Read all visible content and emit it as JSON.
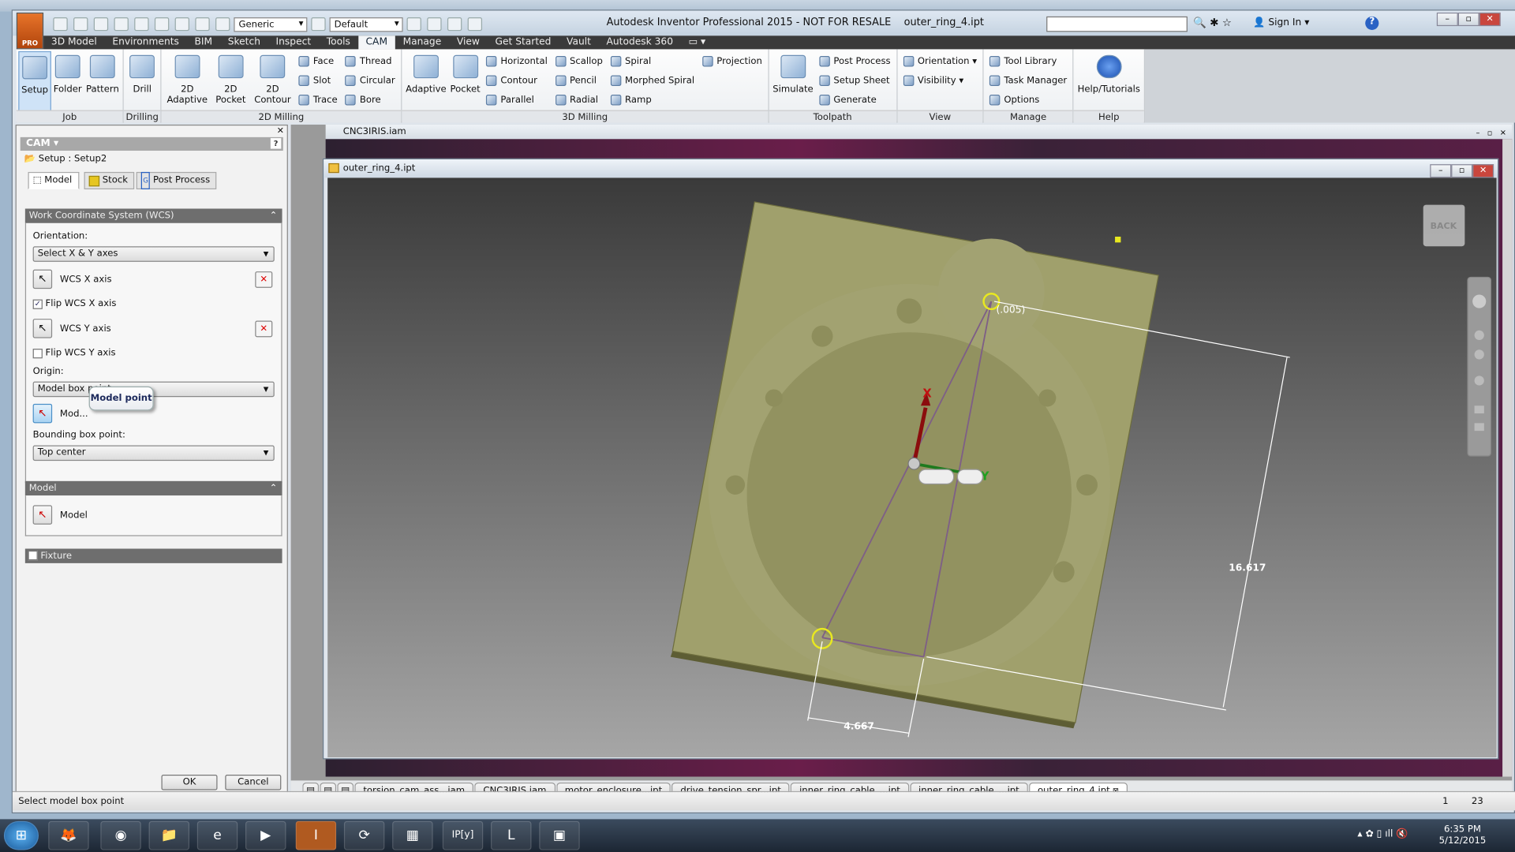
{
  "app": {
    "title": "Autodesk Inventor Professional 2015 - NOT FOR RESALE",
    "document": "outer_ring_4.ipt",
    "logo_label": "PRO",
    "material_combo": "Generic",
    "appearance_combo": "Default",
    "sign_in": "Sign In",
    "help": "?"
  },
  "ribbon_tabs": [
    "3D Model",
    "Environments",
    "BIM",
    "Sketch",
    "Inspect",
    "Tools",
    "CAM",
    "Manage",
    "View",
    "Get Started",
    "Vault",
    "Autodesk 360"
  ],
  "active_tab": "CAM",
  "ribbon_groups": [
    {
      "label": "Job",
      "large": [
        "Setup",
        "Folder",
        "Pattern"
      ]
    },
    {
      "label": "Drilling",
      "large": [
        "Drill"
      ]
    },
    {
      "label": "2D Milling",
      "large": [
        "2D Adaptive",
        "2D Pocket",
        "2D Contour"
      ],
      "small": [
        [
          "Face",
          "Slot",
          "Trace"
        ],
        [
          "Thread",
          "Circular",
          "Bore"
        ]
      ]
    },
    {
      "label": "3D Milling",
      "large": [
        "Adaptive",
        "Pocket"
      ],
      "small": [
        [
          "Horizontal",
          "Contour",
          "Parallel"
        ],
        [
          "Scallop",
          "Pencil",
          "Radial"
        ],
        [
          "Spiral",
          "Morphed Spiral",
          "Ramp"
        ],
        [
          "Projection"
        ]
      ]
    },
    {
      "label": "Toolpath",
      "large": [
        "Simulate"
      ],
      "small": [
        [
          "Post Process",
          "Setup Sheet",
          "Generate"
        ]
      ]
    },
    {
      "label": "View",
      "small": [
        [
          "Orientation ▾",
          "Visibility ▾"
        ]
      ]
    },
    {
      "label": "Manage",
      "small": [
        [
          "Tool Library",
          "Task Manager",
          "Options"
        ]
      ]
    },
    {
      "label": "Help",
      "large": [
        "Help/Tutorials"
      ]
    }
  ],
  "panel": {
    "header": "CAM",
    "setup": "Setup : Setup2",
    "tabs": [
      "Model",
      "Stock",
      "Post Process"
    ],
    "wcs": {
      "title": "Work Coordinate System (WCS)",
      "orientation_label": "Orientation:",
      "orientation_value": "Select X & Y axes",
      "x_axis": "WCS X axis",
      "flip_x": "Flip WCS X axis",
      "flip_x_checked": true,
      "y_axis": "WCS Y axis",
      "flip_y": "Flip WCS Y axis",
      "flip_y_checked": false,
      "origin_label": "Origin:",
      "origin_value": "Model box point",
      "model_point": "Mod...",
      "tooltip": "Model point",
      "bbox_label": "Bounding box point:",
      "bbox_value": "Top center"
    },
    "model": {
      "title": "Model",
      "button": "Model"
    },
    "fixture": {
      "title": "Fixture",
      "checked": false
    },
    "ok": "OK",
    "cancel": "Cancel"
  },
  "outer_window": "CNC3IRIS.iam",
  "inner_window": "outer_ring_4.ipt",
  "viewcube": "BACK",
  "viewport": {
    "dim_width": "4.667",
    "dim_height": "16.617",
    "dim_offset": "(.005)",
    "axis_x": "X",
    "axis_y": "Y",
    "plate_color": "#9e9e6a",
    "x_axis_color": "#8b0d0d",
    "y_axis_color": "#1e7a1e"
  },
  "doc_tabs": [
    "torsion_cam_ass...iam",
    "CNC3IRIS.iam",
    "motor_enclosure...ipt",
    "drive_tension_spr...ipt",
    "inner_ring_cable_...ipt",
    "inner_ring_cable_...ipt",
    "outer_ring_4.ipt"
  ],
  "status": {
    "message": "Select model box point",
    "count1": "1",
    "count2": "23"
  },
  "clock": {
    "time": "6:35 PM",
    "date": "5/12/2015"
  }
}
